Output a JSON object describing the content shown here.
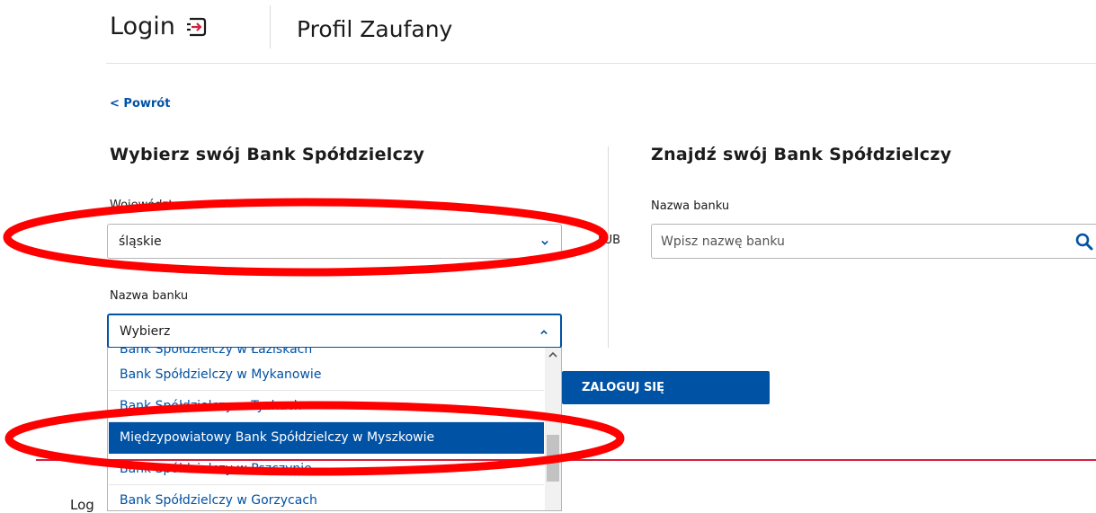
{
  "header": {
    "brand": "Login",
    "brand_icon": "login-arrow-icon",
    "subtitle": "Profil Zaufany"
  },
  "back_link": "< Powrót",
  "left_panel": {
    "heading": "Wybierz swój Bank Spółdzielczy",
    "voivodeship_label": "Województwo",
    "voivodeship_value": "śląskie",
    "bank_label": "Nazwa banku",
    "bank_value": "Wybierz",
    "dropdown_items": [
      "Bank Spółdzielczy w Mykanowie",
      "Bank Spółdzielczy w Tychach",
      "Międzypowiatowy Bank Spółdzielczy w Myszkowie",
      "Bank Spółdzielczy w Pszczynie",
      "Bank Spółdzielczy w Gorzycach"
    ],
    "selected_index": 2
  },
  "or_text": "LUB",
  "right_panel": {
    "heading": "Znajdź swój Bank Spółdzielczy",
    "bank_label": "Nazwa banku",
    "search_placeholder": "Wpisz nazwę banku"
  },
  "login_button": "ZALOGUJ SIĘ",
  "footer_fragment": "Log",
  "colors": {
    "primary": "#0052a5",
    "accent_red": "#d4213d",
    "annotation_red": "#ff0000"
  }
}
